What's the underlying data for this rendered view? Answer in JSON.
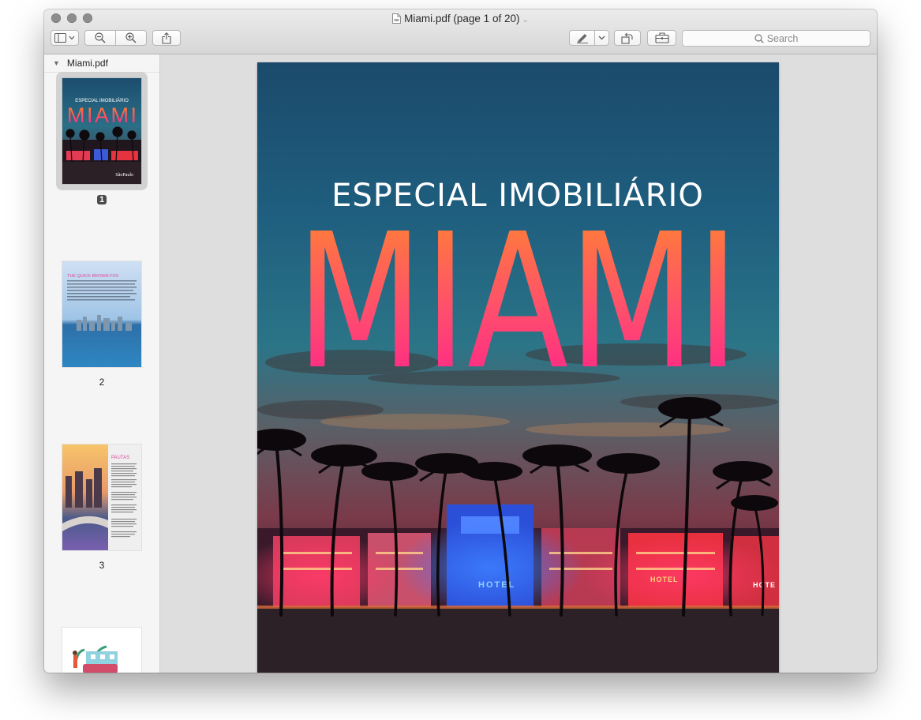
{
  "window": {
    "title": "Miami.pdf (page 1 of 20)",
    "title_caret": "⌄"
  },
  "toolbar": {
    "search_placeholder": "Search"
  },
  "sidebar": {
    "file_name": "Miami.pdf",
    "thumbnails": [
      {
        "page": "1",
        "selected": true
      },
      {
        "page": "2"
      },
      {
        "page": "3"
      }
    ],
    "thumb1": {
      "line1": "ESPECIAL IMOBILIÁRIO",
      "line2": "MIAMI",
      "logo": "SãoPaulo"
    },
    "thumb2": {
      "heading": "THE QUICK BROWN FOX"
    },
    "thumb3": {
      "heading": "PAUTAS"
    }
  },
  "document": {
    "cover_subtitle": "ESPECIAL IMOBILIÁRIO",
    "cover_title": "MIAMI",
    "sign_hotel_1": "HOTEL",
    "sign_hotel_2": "HOTEL",
    "sign_hotel_3": "HOTE"
  },
  "colors": {
    "accent_orange": "#ff8a2a",
    "accent_pink": "#ff1f8e",
    "sky_top": "#1b4c6d"
  }
}
